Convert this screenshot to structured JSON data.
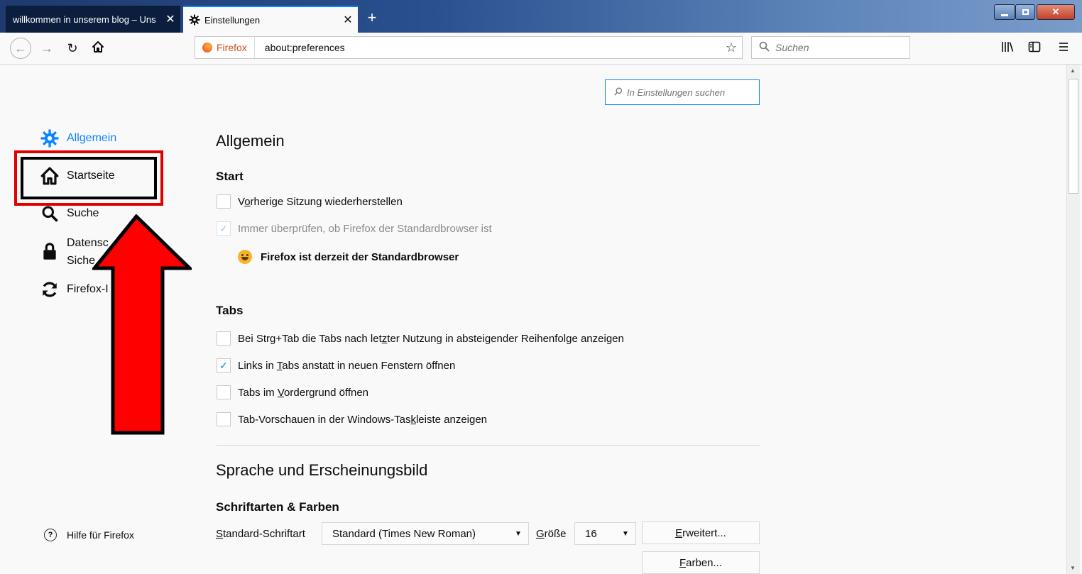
{
  "window": {
    "tabs": [
      {
        "title": "willkommen in unserem blog – Uns",
        "close": "✕"
      },
      {
        "title": "Einstellungen",
        "close": "✕",
        "icon": "gear-icon"
      }
    ],
    "new_tab": "+"
  },
  "navbar": {
    "identity_label": "Firefox",
    "url": "about:preferences",
    "search_placeholder": "Suchen"
  },
  "sidebar": {
    "categories": [
      {
        "label": "Allgemein",
        "icon": "gear-icon",
        "selected": true
      },
      {
        "label": "Startseite",
        "icon": "home-icon"
      },
      {
        "label": "Suche",
        "icon": "search-icon"
      },
      {
        "label": "Datenschutz & Sicherheit",
        "label_line1": "Datensc",
        "label_line2": "Siche",
        "icon": "lock-icon"
      },
      {
        "label": "Firefox-Konto",
        "label_visible": "Firefox-I",
        "icon": "sync-icon"
      }
    ],
    "help": "Hilfe für Firefox"
  },
  "main": {
    "search_placeholder": "In Einstellungen suchen",
    "heading_general": "Allgemein",
    "start": {
      "title": "Start",
      "restore_session_pre": "V",
      "restore_session_ul": "o",
      "restore_session_post": "rherige Sitzung wiederherstellen",
      "always_check": "Immer überprüfen, ob Firefox der Standardbrowser ist",
      "default_status": "Firefox ist derzeit der Standardbrowser"
    },
    "tabs": {
      "title": "Tabs",
      "ctrl_tab_pre": "Bei Strg+Tab die Tabs nach let",
      "ctrl_tab_ul": "z",
      "ctrl_tab_post": "ter Nutzung in absteigender Reihenfolge anzeigen",
      "links_pre": "Links in ",
      "links_ul": "T",
      "links_post": "abs anstatt in neuen Fenstern öffnen",
      "foreground_pre": "Tabs im ",
      "foreground_ul": "V",
      "foreground_post": "ordergrund öffnen",
      "previews_pre": "Tab-Vorschauen in der Windows-Tas",
      "previews_ul": "k",
      "previews_post": "leiste anzeigen"
    },
    "language": {
      "heading": "Sprache und Erscheinungsbild",
      "fonts_title": "Schriftarten & Farben",
      "default_font_ul": "S",
      "default_font_post": "tandard-Schriftart",
      "default_font_value": "Standard (Times New Roman)",
      "size_ul": "G",
      "size_post": "röße",
      "size_value": "16",
      "advanced_ul": "E",
      "advanced_post": "rweitert...",
      "colors_ul": "F",
      "colors_post": "arben..."
    }
  },
  "colors": {
    "accent": "#0a84ff",
    "highlight_red": "#e00000",
    "arrow_red": "#ff0000"
  }
}
